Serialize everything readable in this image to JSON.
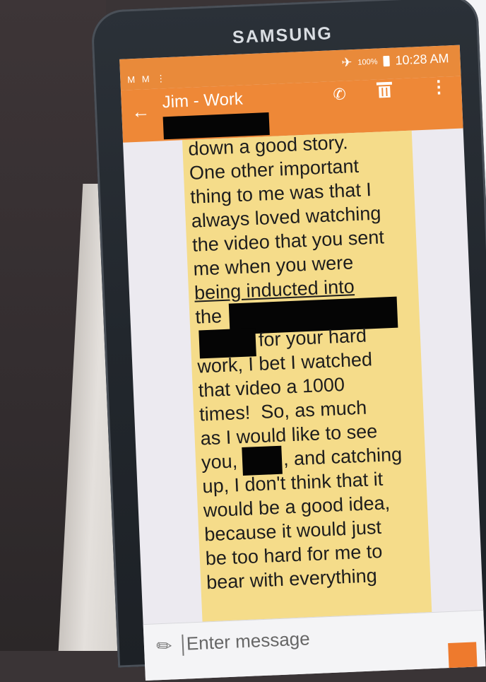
{
  "device": {
    "brand": "SAMSUNG"
  },
  "status_bar": {
    "notification_icons": "M M ⋮",
    "airplane_icon": "airplane-icon",
    "battery_level": "100%",
    "time": "10:28 AM"
  },
  "app_bar": {
    "title": "Jim - Work",
    "back_icon": "arrow-left-icon",
    "call_icon": "phone-icon",
    "delete_icon": "trash-icon",
    "more_icon": "more-vert-icon"
  },
  "message": {
    "lines": [
      "down a good story.",
      "One other important",
      "thing to me was that I",
      "always loved watching",
      "the video that you sent",
      "me when you were",
      "being inducted into",
      "the",
      "for your hard",
      "work, I bet I watched",
      "that video a 1000",
      "times!  So, as much",
      "as I would like to see",
      "you,",
      ", and catching",
      "up, I don't think that it",
      "would be a good idea,",
      "because it would just",
      "be too hard for me to",
      "bear with everything"
    ]
  },
  "composer": {
    "placeholder": "Enter message",
    "attach_icon": "paperclip-icon"
  },
  "colors": {
    "app_bar": "#ee8837",
    "status_bar": "#e98a3a",
    "bubble": "#f5dc8a",
    "screen_bg": "#eceaf0"
  }
}
